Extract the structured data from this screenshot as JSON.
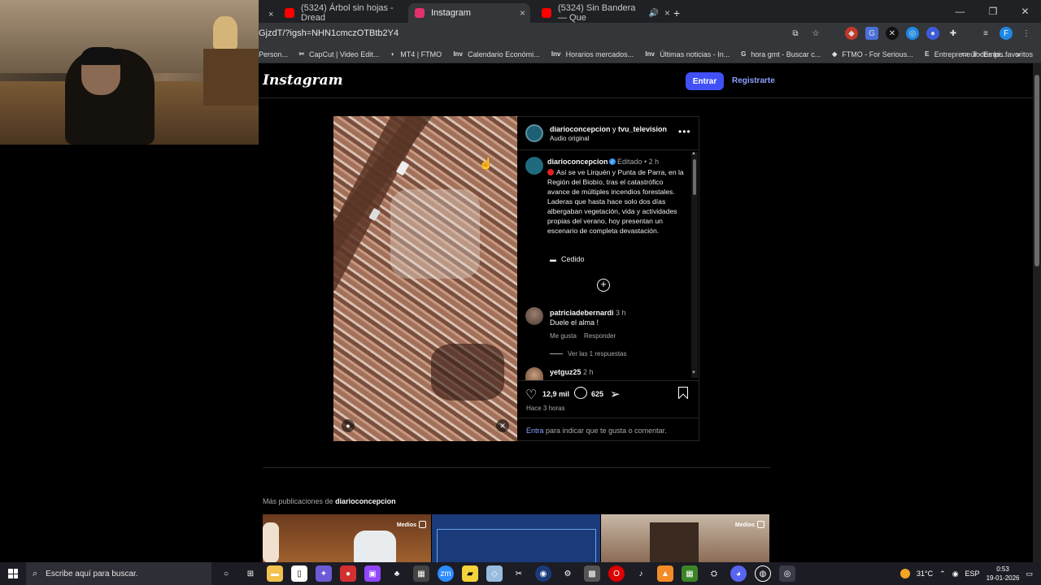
{
  "browser": {
    "tabs": [
      {
        "label": "(5324) Árbol sin hojas - Dread",
        "favicon_color": "#ff0000",
        "active": false
      },
      {
        "label": "Instagram",
        "favicon_color": "#e1306c",
        "active": true
      },
      {
        "label": "(5324) Sin Bandera — Que",
        "favicon_color": "#ff0000",
        "active": false
      }
    ],
    "tab_close": "×",
    "new_tab": "+",
    "window_controls": {
      "minimize": "—",
      "restore": "❐",
      "close": "✕"
    },
    "url": "GjzdT/?igsh=NHN1cmczOTBtb2Y4",
    "bookmarks": [
      {
        "label": "Person...",
        "icon": ""
      },
      {
        "label": "CapCut | Video Edit...",
        "icon": "✂"
      },
      {
        "label": "MT4 | FTMO",
        "icon": "◐"
      },
      {
        "label": "Calendario Económi...",
        "icon": "Inv"
      },
      {
        "label": "Horarios mercados...",
        "icon": "Inv"
      },
      {
        "label": "Últimas noticias - In...",
        "icon": "Inv"
      },
      {
        "label": "hora gmt - Buscar c...",
        "icon": "G"
      },
      {
        "label": "FTMO - For Serious...",
        "icon": "◆"
      },
      {
        "label": "Entrepreneur - Empi...",
        "icon": "E"
      }
    ],
    "bookmarks_overflow": "»",
    "all_bookmarks": "Todos los favoritos"
  },
  "instagram": {
    "logo": "Instagram",
    "login_button": "Entrar",
    "signup_link": "Registrarte",
    "post": {
      "authors": "diarioconcepcion",
      "authors_join": " y ",
      "coauthor": "tvu_television",
      "audio": "Audio original",
      "more": "•••",
      "caption_user": "diarioconcepcion",
      "caption_meta": "Editado • 2 h",
      "caption_text": "Así se ve Lirquén y Punta de Parra, en la Región del Biobío, tras el catastrófico avance de múltiples incendios forestales. Laderas que hasta hace solo dos días albergaban vegetación, vida y actividades propias del verano, hoy presentan un escenario de completa devastación.",
      "credit": "Cedido",
      "comments": [
        {
          "user": "patriciadebernardi",
          "time": "3 h",
          "text": "Duele el alma !",
          "like": "Me gusta",
          "reply": "Responder",
          "view_replies": "Ver las 1 respuestas"
        },
        {
          "user": "yetguz25",
          "time": "2 h"
        }
      ],
      "likes": "12,9 mil",
      "comment_count": "625",
      "time_ago": "Hace 3 horas",
      "login_link": "Entra",
      "login_prompt": " para indicar que te gusta o comentar."
    },
    "more_posts_prefix": "Más publicaciones de ",
    "more_posts_user": "diarioconcepcion",
    "thumb_badge": "Medios"
  },
  "taskbar": {
    "search_placeholder": "Escribe aquí para buscar.",
    "temperature": "31°C",
    "language": "ESP",
    "time": "0:53",
    "date": "19-01-2026"
  }
}
